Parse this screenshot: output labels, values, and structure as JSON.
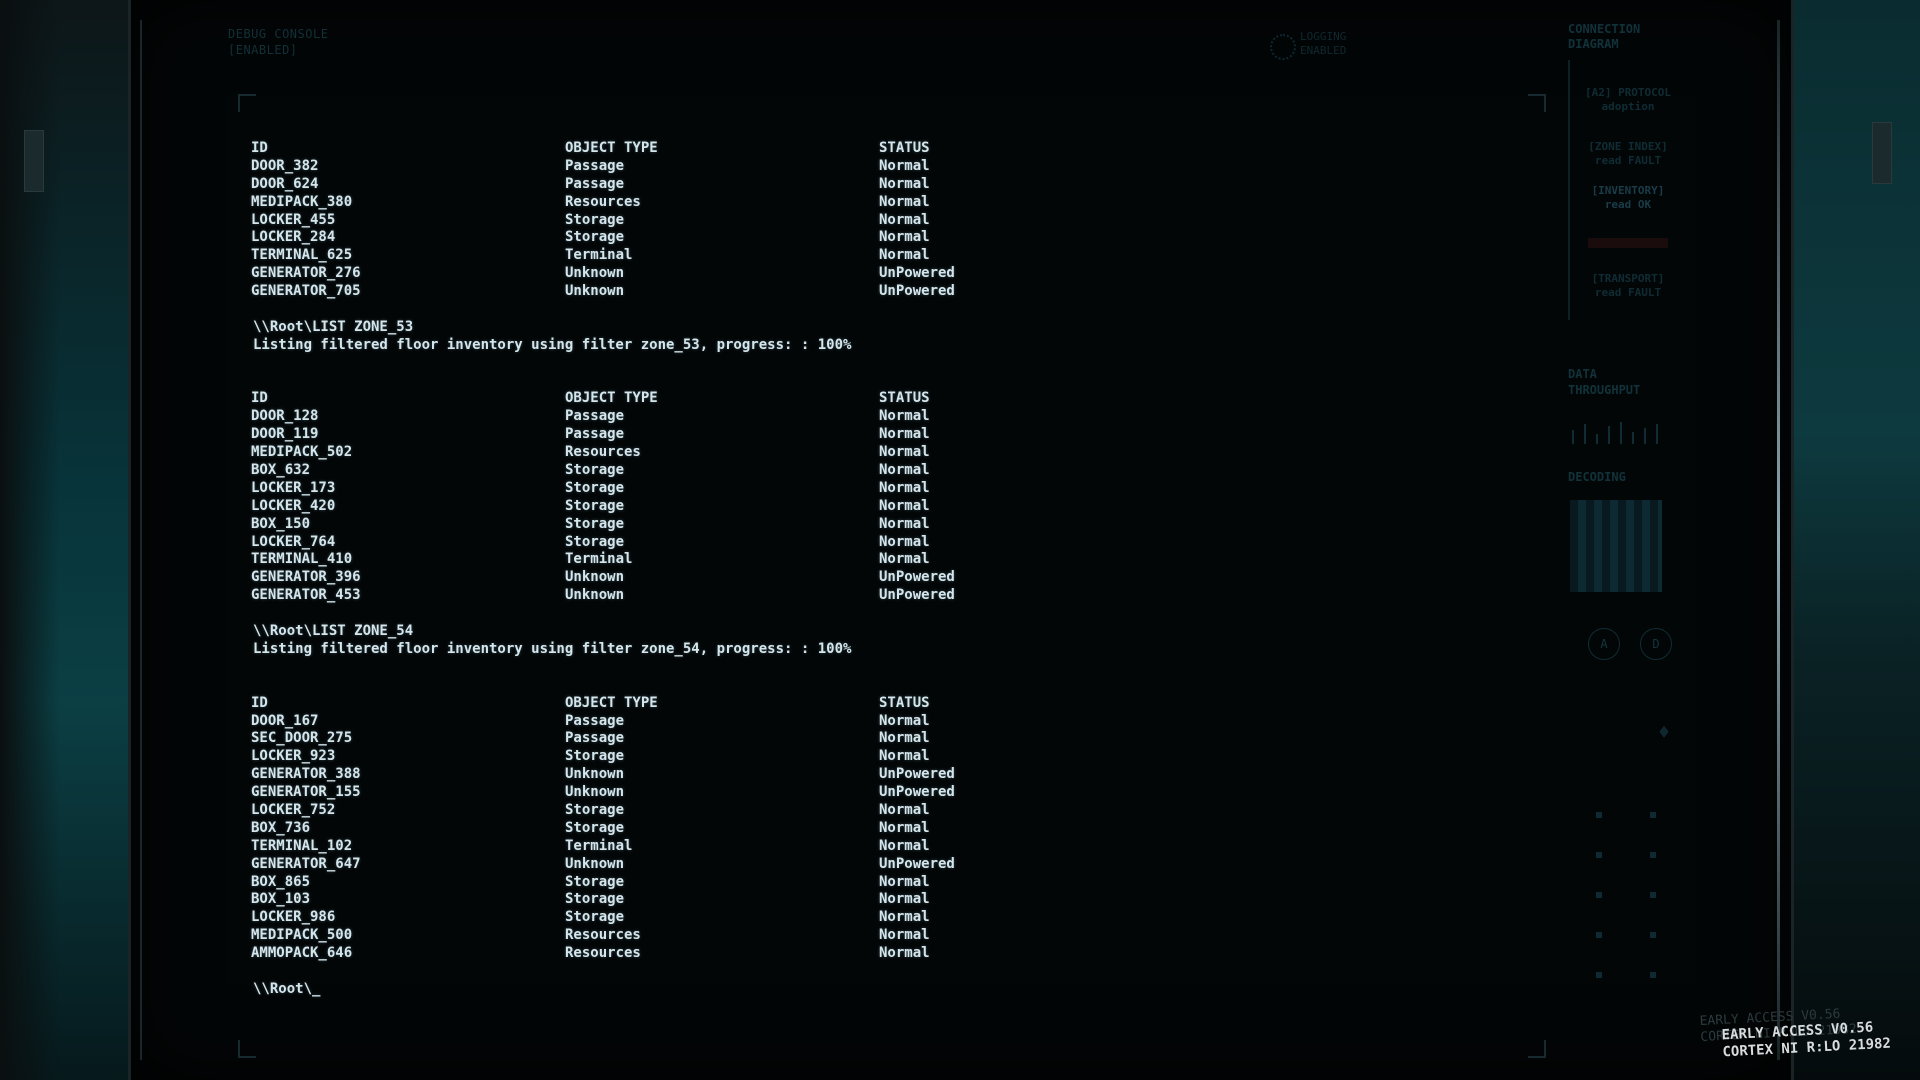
{
  "header": {
    "debug_console": "DEBUG CONSOLE\n[ENABLED]",
    "top_info": "LOGGING\nENABLED"
  },
  "terminal": {
    "blocks": [
      {
        "command": "",
        "message": "",
        "headers": [
          "ID",
          "OBJECT TYPE",
          "STATUS"
        ],
        "rows": [
          [
            "DOOR_382",
            "Passage",
            "Normal"
          ],
          [
            "DOOR_624",
            "Passage",
            "Normal"
          ],
          [
            "MEDIPACK_380",
            "Resources",
            "Normal"
          ],
          [
            "LOCKER_455",
            "Storage",
            "Normal"
          ],
          [
            "LOCKER_284",
            "Storage",
            "Normal"
          ],
          [
            "TERMINAL_625",
            "Terminal",
            "Normal"
          ],
          [
            "GENERATOR_276",
            "Unknown",
            "UnPowered"
          ],
          [
            "GENERATOR_705",
            "Unknown",
            "UnPowered"
          ]
        ]
      },
      {
        "command": "\\\\Root\\LIST ZONE_53",
        "message": "Listing filtered floor inventory using filter zone_53, progress: : 100%",
        "headers": [
          "ID",
          "OBJECT TYPE",
          "STATUS"
        ],
        "rows": [
          [
            "DOOR_128",
            "Passage",
            "Normal"
          ],
          [
            "DOOR_119",
            "Passage",
            "Normal"
          ],
          [
            "MEDIPACK_502",
            "Resources",
            "Normal"
          ],
          [
            "BOX_632",
            "Storage",
            "Normal"
          ],
          [
            "LOCKER_173",
            "Storage",
            "Normal"
          ],
          [
            "LOCKER_420",
            "Storage",
            "Normal"
          ],
          [
            "BOX_150",
            "Storage",
            "Normal"
          ],
          [
            "LOCKER_764",
            "Storage",
            "Normal"
          ],
          [
            "TERMINAL_410",
            "Terminal",
            "Normal"
          ],
          [
            "GENERATOR_396",
            "Unknown",
            "UnPowered"
          ],
          [
            "GENERATOR_453",
            "Unknown",
            "UnPowered"
          ]
        ]
      },
      {
        "command": "\\\\Root\\LIST ZONE_54",
        "message": "Listing filtered floor inventory using filter zone_54, progress: : 100%",
        "headers": [
          "ID",
          "OBJECT TYPE",
          "STATUS"
        ],
        "rows": [
          [
            "DOOR_167",
            "Passage",
            "Normal"
          ],
          [
            "SEC_DOOR_275",
            "Passage",
            "Normal"
          ],
          [
            "LOCKER_923",
            "Storage",
            "Normal"
          ],
          [
            "GENERATOR_388",
            "Unknown",
            "UnPowered"
          ],
          [
            "GENERATOR_155",
            "Unknown",
            "UnPowered"
          ],
          [
            "LOCKER_752",
            "Storage",
            "Normal"
          ],
          [
            "BOX_736",
            "Storage",
            "Normal"
          ],
          [
            "TERMINAL_102",
            "Terminal",
            "Normal"
          ],
          [
            "GENERATOR_647",
            "Unknown",
            "UnPowered"
          ],
          [
            "BOX_865",
            "Storage",
            "Normal"
          ],
          [
            "BOX_103",
            "Storage",
            "Normal"
          ],
          [
            "LOCKER_986",
            "Storage",
            "Normal"
          ],
          [
            "MEDIPACK_500",
            "Resources",
            "Normal"
          ],
          [
            "AMMOPACK_646",
            "Resources",
            "Normal"
          ]
        ]
      }
    ],
    "prompt": "\\\\Root\\_"
  },
  "side_panel": {
    "connection_title": "CONNECTION\nDIAGRAM",
    "items": [
      "[A2] PROTOCOL\nadoption",
      "[ZONE INDEX]\nread FAULT",
      "[INVENTORY]\nread OK",
      "[TRANSPORT]\nread FAULT"
    ],
    "data_title": "DATA\nTHROUGHPUT",
    "decoding_title": "DECODING",
    "button_a": "A",
    "button_d": "D"
  },
  "footer": {
    "ghost": "EARLY ACCESS V0.56\nCORTEX NI R:LO 21982",
    "version": "EARLY ACCESS V0.56\nCORTEX NI R:LO 21982"
  },
  "colors": {
    "terminal_text": "#d4e6ec",
    "background": "#020405",
    "accent_teal": "#0b3f44"
  }
}
